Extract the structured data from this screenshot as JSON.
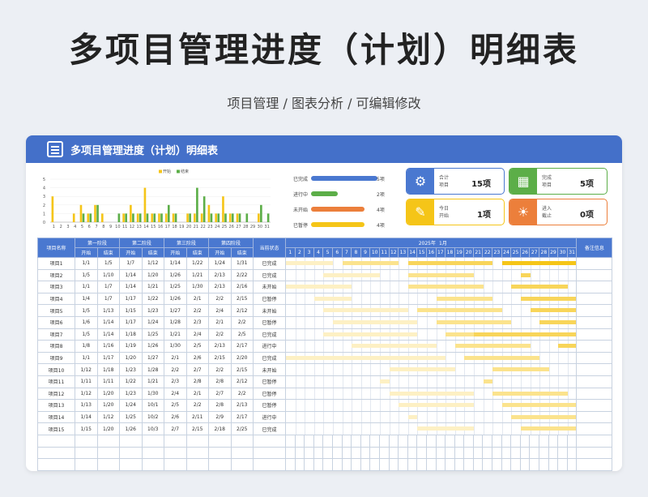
{
  "page": {
    "title": "多项目管理进度（计划）明细表",
    "subtitle": "项目管理 / 图表分析 / 可编辑修改"
  },
  "card_title": "多项目管理进度（计划）明细表",
  "chart_data": {
    "type": "bar",
    "categories": [
      "1",
      "2",
      "3",
      "4",
      "5",
      "6",
      "7",
      "8",
      "9",
      "10",
      "11",
      "12",
      "13",
      "14",
      "15",
      "16",
      "17",
      "18",
      "19",
      "20",
      "21",
      "22",
      "23",
      "24",
      "25",
      "26",
      "27",
      "28",
      "29",
      "30",
      "31"
    ],
    "series": [
      {
        "name": "开始",
        "values": [
          3,
          0,
          0,
          1,
          2,
          1,
          2,
          1,
          0,
          0,
          1,
          2,
          1,
          4,
          1,
          1,
          1,
          1,
          0,
          1,
          1,
          1,
          2,
          1,
          3,
          1,
          1,
          0,
          0,
          1,
          0
        ]
      },
      {
        "name": "结束",
        "values": [
          0,
          0,
          0,
          0,
          1,
          1,
          2,
          0,
          0,
          1,
          1,
          1,
          1,
          1,
          1,
          1,
          2,
          1,
          0,
          1,
          4,
          3,
          1,
          1,
          1,
          1,
          1,
          1,
          0,
          2,
          1
        ]
      }
    ],
    "ylim": [
      0,
      5
    ],
    "yticks": [
      "0",
      "1",
      "2",
      "3",
      "4",
      "5"
    ],
    "legend": "top",
    "colors": [
      "#f5c518",
      "#5cae48"
    ]
  },
  "progress": [
    {
      "label": "已完成",
      "value": 5,
      "text": "5项",
      "color": "#4a78d0"
    },
    {
      "label": "进行中",
      "value": 2,
      "text": "2项",
      "color": "#5cae48"
    },
    {
      "label": "未开始",
      "value": 4,
      "text": "4项",
      "color": "#ec7f3b"
    },
    {
      "label": "已暂停",
      "value": 4,
      "text": "4项",
      "color": "#f5c518"
    }
  ],
  "stats": [
    {
      "l1": "合计",
      "l2": "项目",
      "value": "15项",
      "color": "#4a78d0",
      "icon": "gear-icon"
    },
    {
      "l1": "完成",
      "l2": "项目",
      "value": "5项",
      "color": "#5cae48",
      "icon": "building-icon"
    },
    {
      "l1": "今日",
      "l2": "开始",
      "value": "1项",
      "color": "#f5c518",
      "icon": "note-icon"
    },
    {
      "l1": "进入",
      "l2": "截止",
      "value": "0项",
      "color": "#ec7f3b",
      "icon": "lightbulb-icon"
    }
  ],
  "table": {
    "h_name": "项目名称",
    "h_status": "当前状态",
    "h_month_year": "2025年",
    "h_month": "1月",
    "h_notes": "备注信息",
    "phases": [
      "第一阶段",
      "第二阶段",
      "第三阶段",
      "第四阶段"
    ],
    "sub": [
      "开始",
      "结束"
    ],
    "days": [
      "1",
      "2",
      "3",
      "4",
      "5",
      "6",
      "7",
      "8",
      "9",
      "10",
      "11",
      "12",
      "13",
      "14",
      "15",
      "16",
      "17",
      "18",
      "19",
      "20",
      "21",
      "22",
      "23",
      "24",
      "25",
      "26",
      "27",
      "28",
      "29",
      "30",
      "31"
    ],
    "rows": [
      {
        "name": "项目1",
        "d": [
          "1/1",
          "1/5",
          "1/7",
          "1/12",
          "1/14",
          "1/22",
          "1/24",
          "1/31"
        ],
        "status": "已完成"
      },
      {
        "name": "项目2",
        "d": [
          "1/5",
          "1/10",
          "1/14",
          "1/20",
          "1/26",
          "1/21",
          "2/13",
          "2/22"
        ],
        "status": "已完成"
      },
      {
        "name": "项目3",
        "d": [
          "1/1",
          "1/7",
          "1/14",
          "1/21",
          "1/25",
          "1/30",
          "2/13",
          "2/16"
        ],
        "status": "未开始"
      },
      {
        "name": "项目4",
        "d": [
          "1/4",
          "1/7",
          "1/17",
          "1/22",
          "1/26",
          "2/1",
          "2/2",
          "2/15"
        ],
        "status": "已暂停"
      },
      {
        "name": "项目5",
        "d": [
          "1/5",
          "1/13",
          "1/15",
          "1/23",
          "1/27",
          "2/2",
          "2/4",
          "2/12"
        ],
        "status": "未开始"
      },
      {
        "name": "项目6",
        "d": [
          "1/6",
          "1/14",
          "1/17",
          "1/24",
          "1/28",
          "2/3",
          "2/1",
          "2/2"
        ],
        "status": "已暂停"
      },
      {
        "name": "项目7",
        "d": [
          "1/5",
          "1/14",
          "1/18",
          "1/25",
          "1/21",
          "2/4",
          "2/2",
          "2/5"
        ],
        "status": "已完成"
      },
      {
        "name": "项目8",
        "d": [
          "1/8",
          "1/16",
          "1/19",
          "1/26",
          "1/30",
          "2/5",
          "2/13",
          "2/17"
        ],
        "status": "进行中"
      },
      {
        "name": "项目9",
        "d": [
          "1/1",
          "1/17",
          "1/20",
          "1/27",
          "2/1",
          "2/6",
          "2/15",
          "2/20"
        ],
        "status": "已完成"
      },
      {
        "name": "项目10",
        "d": [
          "1/12",
          "1/18",
          "1/23",
          "1/28",
          "2/2",
          "2/7",
          "2/2",
          "2/15"
        ],
        "status": "未开始"
      },
      {
        "name": "项目11",
        "d": [
          "1/11",
          "1/11",
          "1/22",
          "1/21",
          "2/3",
          "2/8",
          "2/8",
          "2/12"
        ],
        "status": "已暂停"
      },
      {
        "name": "项目12",
        "d": [
          "1/12",
          "1/20",
          "1/23",
          "1/30",
          "2/4",
          "2/1",
          "2/7",
          "2/2"
        ],
        "status": "已暂停"
      },
      {
        "name": "项目13",
        "d": [
          "1/13",
          "1/20",
          "1/24",
          "10/1",
          "2/5",
          "2/2",
          "2/8",
          "2/13"
        ],
        "status": "已暂停"
      },
      {
        "name": "项目14",
        "d": [
          "1/14",
          "1/12",
          "1/25",
          "10/2",
          "2/6",
          "2/11",
          "2/9",
          "2/17"
        ],
        "status": "进行中"
      },
      {
        "name": "项目15",
        "d": [
          "1/15",
          "1/20",
          "1/26",
          "10/3",
          "2/7",
          "2/15",
          "2/18",
          "2/25"
        ],
        "status": "已完成"
      }
    ],
    "empty_rows": 3
  }
}
